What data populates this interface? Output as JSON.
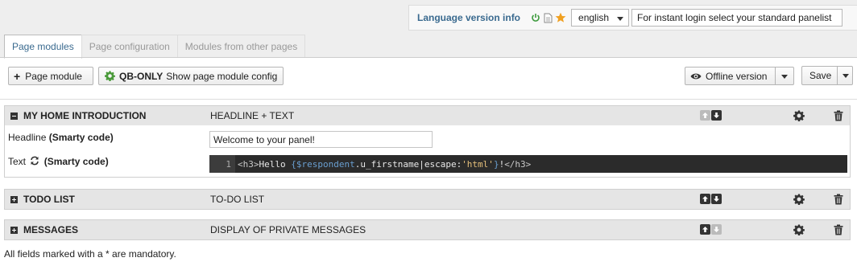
{
  "lang_bar": {
    "label": "Language version info",
    "selected_language": "english",
    "login_input_value": "For instant login select your standard panelist"
  },
  "tabs": [
    {
      "label": "Page modules",
      "active": true
    },
    {
      "label": "Page configuration",
      "active": false
    },
    {
      "label": "Modules from other pages",
      "active": false
    }
  ],
  "toolbar": {
    "add_module_label": "Page module",
    "config_strong": "QB-ONLY",
    "config_label": "Show page module config",
    "offline_label": "Offline version",
    "save_label": "Save"
  },
  "modules": [
    {
      "title": "MY HOME INTRODUCTION",
      "type": "HEADLINE + TEXT",
      "expanded": true,
      "fields": {
        "headline_label": "Headline",
        "headline_suffix": "(Smarty code)",
        "headline_value": "Welcome to your panel!",
        "text_label": "Text",
        "text_suffix": "(Smarty code)",
        "code_line_number": "1",
        "code": {
          "open_tag": "<h3>",
          "hello": "Hello ",
          "brace_open": "{",
          "var": "$respondent",
          "prop": ".u_firstname|escape:",
          "str": "'html'",
          "brace_close": "}",
          "bang": "!",
          "close_tag": "</h3>"
        }
      }
    },
    {
      "title": "TODO LIST",
      "type": "TO-DO LIST",
      "expanded": false
    },
    {
      "title": "MESSAGES",
      "type": "DISPLAY OF PRIVATE MESSAGES",
      "expanded": false
    }
  ],
  "footer_note": "All fields marked with a * are mandatory.",
  "colors": {
    "accent_blue": "#3a6a8f",
    "power_green": "#3c9a3c",
    "star_orange": "#f0a020",
    "code_bg": "#2b2b2b"
  }
}
